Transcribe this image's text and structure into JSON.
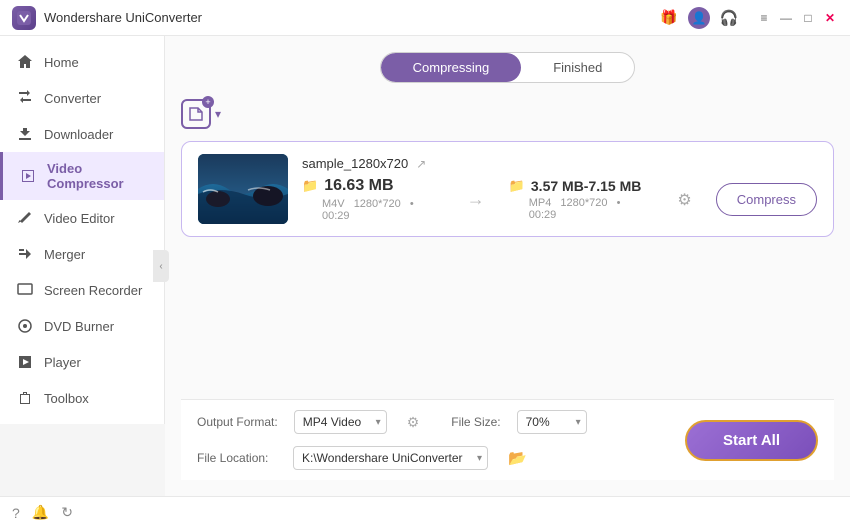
{
  "app": {
    "title": "Wondershare UniConverter",
    "logo_text": "W"
  },
  "titlebar": {
    "icons": {
      "gift": "🎁",
      "user": "👤",
      "headset": "🎧",
      "menu": "≡",
      "minimize": "—",
      "maximize": "□",
      "close": "✕"
    }
  },
  "sidebar": {
    "items": [
      {
        "id": "home",
        "label": "Home",
        "active": false
      },
      {
        "id": "converter",
        "label": "Converter",
        "active": false
      },
      {
        "id": "downloader",
        "label": "Downloader",
        "active": false
      },
      {
        "id": "video-compressor",
        "label": "Video Compressor",
        "active": true
      },
      {
        "id": "video-editor",
        "label": "Video Editor",
        "active": false
      },
      {
        "id": "merger",
        "label": "Merger",
        "active": false
      },
      {
        "id": "screen-recorder",
        "label": "Screen Recorder",
        "active": false
      },
      {
        "id": "dvd-burner",
        "label": "DVD Burner",
        "active": false
      },
      {
        "id": "player",
        "label": "Player",
        "active": false
      },
      {
        "id": "toolbox",
        "label": "Toolbox",
        "active": false
      }
    ]
  },
  "tabs": {
    "compressing": "Compressing",
    "finished": "Finished"
  },
  "add_button": {
    "chevron": "▾"
  },
  "file_card": {
    "name": "sample_1280x720",
    "source": {
      "size": "16.63 MB",
      "format": "M4V",
      "resolution": "1280*720",
      "duration": "00:29"
    },
    "output": {
      "size": "3.57 MB-7.15 MB",
      "format": "MP4",
      "resolution": "1280*720",
      "duration": "00:29"
    },
    "compress_label": "Compress"
  },
  "bottom": {
    "output_format_label": "Output Format:",
    "output_format_value": "MP4 Video",
    "file_size_label": "File Size:",
    "file_size_value": "70%",
    "file_location_label": "File Location:",
    "file_location_value": "K:\\Wondershare UniConverter",
    "start_all_label": "Start All"
  },
  "app_bottom": {
    "icons": [
      "?",
      "🔔",
      "↻"
    ]
  }
}
